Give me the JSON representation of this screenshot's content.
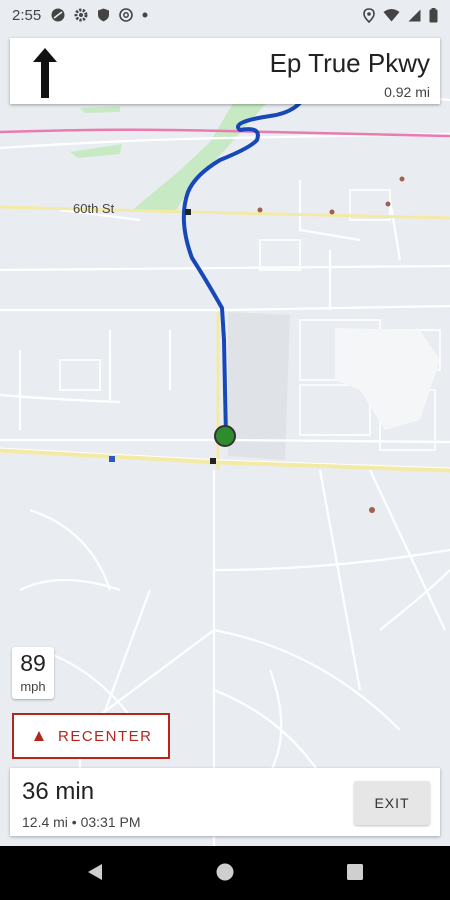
{
  "status_bar": {
    "time": "2:55"
  },
  "instruction": {
    "street": "Ep True Pkwy",
    "distance": "0.92 mi"
  },
  "map": {
    "street_label": "60th St"
  },
  "speed": {
    "value": "89",
    "unit": "mph"
  },
  "recenter": {
    "label": "RECENTER"
  },
  "trip": {
    "duration": "36 min",
    "details": "12.4 mi • 03:31 PM",
    "exit_label": "EXIT"
  },
  "colors": {
    "route": "#1847b8",
    "alert_red": "#b3261e",
    "park": "#c7e9c4",
    "major_road": "#f3eaa6",
    "rail": "#e97bb0"
  }
}
